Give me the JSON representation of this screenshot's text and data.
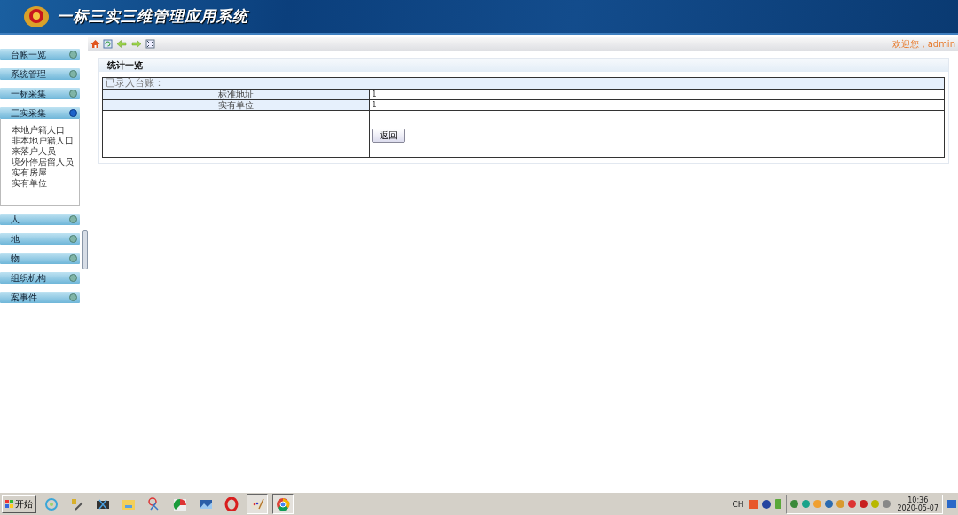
{
  "header": {
    "title": "一标三实三维管理应用系统"
  },
  "toolbar": {
    "welcome": "欢迎您，admin"
  },
  "sidebar": {
    "items": [
      {
        "label": "台帐一览",
        "expanded": false
      },
      {
        "label": "系统管理",
        "expanded": false
      },
      {
        "label": "一标采集",
        "expanded": false
      },
      {
        "label": "三实采集",
        "expanded": true,
        "children": [
          {
            "label": "本地户籍人口"
          },
          {
            "label": "非本地户籍人口"
          },
          {
            "label": "来落户人员"
          },
          {
            "label": "境外停居留人员"
          },
          {
            "label": "实有房屋"
          },
          {
            "label": "实有单位"
          }
        ]
      },
      {
        "label": "人",
        "expanded": false
      },
      {
        "label": "地",
        "expanded": false
      },
      {
        "label": "物",
        "expanded": false
      },
      {
        "label": "组织机构",
        "expanded": false
      },
      {
        "label": "案事件",
        "expanded": false
      }
    ]
  },
  "panel": {
    "title": "统计一览",
    "caption": "已录入台账：",
    "rows": [
      {
        "label": "标准地址",
        "value": "1"
      },
      {
        "label": "实有单位",
        "value": "1"
      }
    ],
    "button": "返回"
  },
  "taskbar": {
    "start": "开始",
    "apps": [
      {
        "kind": "swirl",
        "selected": false
      },
      {
        "kind": "tools",
        "selected": false
      },
      {
        "kind": "film",
        "selected": false
      },
      {
        "kind": "folder",
        "selected": false
      },
      {
        "kind": "scissors",
        "selected": false
      },
      {
        "kind": "chart",
        "selected": false
      },
      {
        "kind": "photo",
        "selected": false
      },
      {
        "kind": "opera",
        "selected": false
      },
      {
        "kind": "paint",
        "selected": true
      },
      {
        "kind": "chrome",
        "selected": true
      }
    ],
    "language": "CH",
    "time": "10:36",
    "date": "2020-05-07"
  }
}
